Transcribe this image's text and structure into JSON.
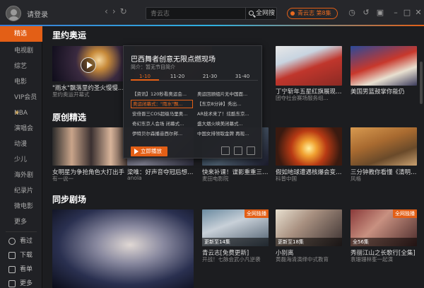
{
  "header": {
    "login": "请登录",
    "search_placeholder": "青云志",
    "search_button": "全网搜",
    "now_playing": "青云志 第8集"
  },
  "sidebar": {
    "items": [
      {
        "label": "精选"
      },
      {
        "label": "电视剧"
      },
      {
        "label": "综艺"
      },
      {
        "label": "电影"
      },
      {
        "label": "VIP会员"
      },
      {
        "label": "NBA"
      },
      {
        "label": "演唱会"
      },
      {
        "label": "动漫"
      },
      {
        "label": "少儿"
      },
      {
        "label": "海外剧"
      },
      {
        "label": "纪录片"
      },
      {
        "label": "微电影"
      },
      {
        "label": "更多"
      }
    ],
    "bottom": [
      {
        "label": "看过"
      },
      {
        "label": "下载"
      },
      {
        "label": "看单"
      },
      {
        "label": "更多"
      }
    ]
  },
  "sections": {
    "olympics": {
      "title": "里约奥运",
      "cards": [
        {
          "caption": "\"雨水\"飘落里约圣火慢慢...",
          "sub": "里约奥运开幕式"
        },
        {
          "caption": "丁宁斩年五星红旗展现范...",
          "sub": "团夺社会赛场服务组..."
        },
        {
          "caption": "美国男篮鼓掌你能仍"
        }
      ]
    },
    "original": {
      "title": "原创精选",
      "cards": [
        {
          "caption": "女明星为争抢角色大打出手",
          "sub": "有一说一"
        },
        {
          "caption": "梁唯：好声音夺冠后想做...",
          "sub": "anola"
        },
        {
          "caption": "快来补课！谍影重重三部...",
          "sub": "麦田电影院"
        },
        {
          "caption": "假如地球遭遇核爆会变成...",
          "sub": "科普中国"
        },
        {
          "caption": "三分钟教你看懂《清明上...",
          "sub": "风格"
        }
      ]
    },
    "sync": {
      "title": "同步剧场",
      "cards": [
        {
          "caption": "青云志[免费更新]",
          "sub": "开战！七脉会武小凡逆袭",
          "badge": "全网独播",
          "ep": "更新至14集"
        },
        {
          "caption": "小别离",
          "sub": "黄磊海清演绎中式教育",
          "ep": "更新至18集"
        },
        {
          "caption": "秀丽江山之长歌行[全集]",
          "sub": "袁珊珊林峯一起演",
          "badge": "全网独播",
          "ep": "全56集"
        }
      ]
    }
  },
  "popup": {
    "title": "巴西舞者创意无限点燃现场",
    "sub": "简介：暂无节目简介",
    "tabs": [
      "1-10",
      "11-20",
      "21-30",
      "31-40"
    ],
    "episodes": [
      "【资讯】120秒看奥运会...",
      "奥运回顾组片无中国面...",
      "奥运闭幕式：\"雨水\"飘...",
      "【东京8分钟】秀出...",
      "安倍晋三COS超级马里奥...",
      "AR技术来了！炫酷东京...",
      "奇幻东京人会场 闭幕式...",
      "盛大烟火映美闭幕式...",
      "伊特贝尔森播音西尔邦...",
      "中国女排领取金牌 再现..."
    ],
    "play": "立即播放"
  },
  "colors": {
    "accent": "#e35f16",
    "background": "#1c1d20"
  }
}
